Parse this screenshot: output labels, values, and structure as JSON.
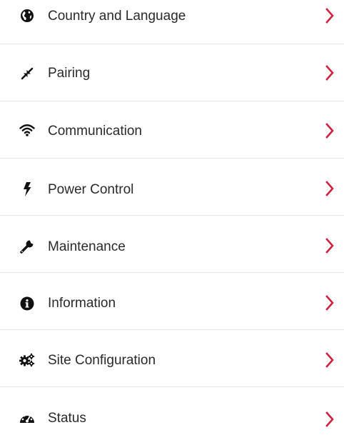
{
  "menu": {
    "accent_color": "#d0213f",
    "items": [
      {
        "label": "Country and Language",
        "icon": "globe-icon"
      },
      {
        "label": "Pairing",
        "icon": "pairing-arrows-icon"
      },
      {
        "label": "Communication",
        "icon": "wifi-icon"
      },
      {
        "label": "Power Control",
        "icon": "lightning-bolt-icon"
      },
      {
        "label": "Maintenance",
        "icon": "wrench-icon"
      },
      {
        "label": "Information",
        "icon": "info-circle-icon"
      },
      {
        "label": "Site Configuration",
        "icon": "gears-icon"
      },
      {
        "label": "Status",
        "icon": "speedometer-icon"
      }
    ]
  }
}
